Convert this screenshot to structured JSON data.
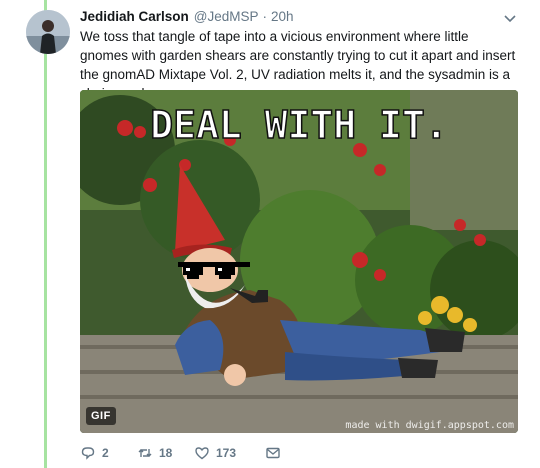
{
  "tweet": {
    "display_name": "Jedidiah Carlson",
    "handle": "@JedMSP",
    "separator": "·",
    "time": "20h",
    "text": "We toss that tangle of tape into a vicious environment where little gnomes with garden shears are constantly trying to cut it apart and insert the gnomAD Mixtape Vol. 2, UV radiation melts it, and the sysadmin is a chain smoker."
  },
  "media": {
    "overlay_text": "DEAL WITH IT.",
    "badge": "GIF",
    "watermark": "made with dwigif.appspot.com"
  },
  "actions": {
    "reply_count": "2",
    "retweet_count": "18",
    "like_count": "173"
  },
  "colors": {
    "thread_line": "#a6e3a1",
    "text": "#14171a",
    "muted": "#657786"
  },
  "icons": [
    "more-caret-icon",
    "reply-icon",
    "retweet-icon",
    "like-heart-icon",
    "direct-message-icon"
  ]
}
